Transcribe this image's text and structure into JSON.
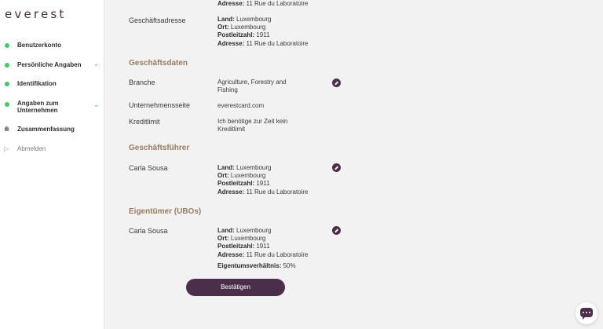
{
  "sidebar": {
    "logo": "everest",
    "items": [
      {
        "label": "Benutzerkonto"
      },
      {
        "label": "Persönliche Angaben"
      },
      {
        "label": "Identifikation"
      },
      {
        "label": "Angaben zum Unternehmen"
      },
      {
        "label": "Zusammenfassung"
      },
      {
        "label": "Abmelden"
      }
    ]
  },
  "main": {
    "top_partial": {
      "label": "Adresse:",
      "value": "11 Rue du Laboratoire"
    },
    "business_address": {
      "label": "Geschäftsadresse",
      "land_label": "Land:",
      "land": "Luxembourg",
      "ort_label": "Ort:",
      "ort": "Luxembourg",
      "plz_label": "Postleitzahl:",
      "plz": "1911",
      "addr_label": "Adresse:",
      "addr": "11 Rue du Laboratoire"
    },
    "business_data": {
      "title": "Geschäftsdaten",
      "branche_label": "Branche",
      "branche": "Agriculture, Forestry and Fishing",
      "website_label": "Unternehmensseite",
      "website": "everestcard.com",
      "credit_label": "Kreditlimit",
      "credit": "Ich benötige zur Zeit kein Kreditlimit"
    },
    "manager": {
      "title": "Geschäftsführer",
      "name": "Carla Sousa",
      "land_label": "Land:",
      "land": "Luxembourg",
      "ort_label": "Ort:",
      "ort": "Luxembourg",
      "plz_label": "Postleitzahl:",
      "plz": "1911",
      "addr_label": "Adresse:",
      "addr": "11 Rue du Laboratoire"
    },
    "owner": {
      "title": "Eigentümer (UBOs)",
      "name": "Carla Sousa",
      "land_label": "Land:",
      "land": "Luxembourg",
      "ort_label": "Ort:",
      "ort": "Luxembourg",
      "plz_label": "Postleitzahl:",
      "plz": "1911",
      "addr_label": "Adresse:",
      "addr": "11 Rue du Laboratoire",
      "share_label": "Eigentumsverhältnis:",
      "share": "50%"
    },
    "confirm_label": "Bestätigen"
  },
  "colors": {
    "accent": "#4b2e4a",
    "section": "#9a7b62",
    "done": "#3ecf6a"
  }
}
